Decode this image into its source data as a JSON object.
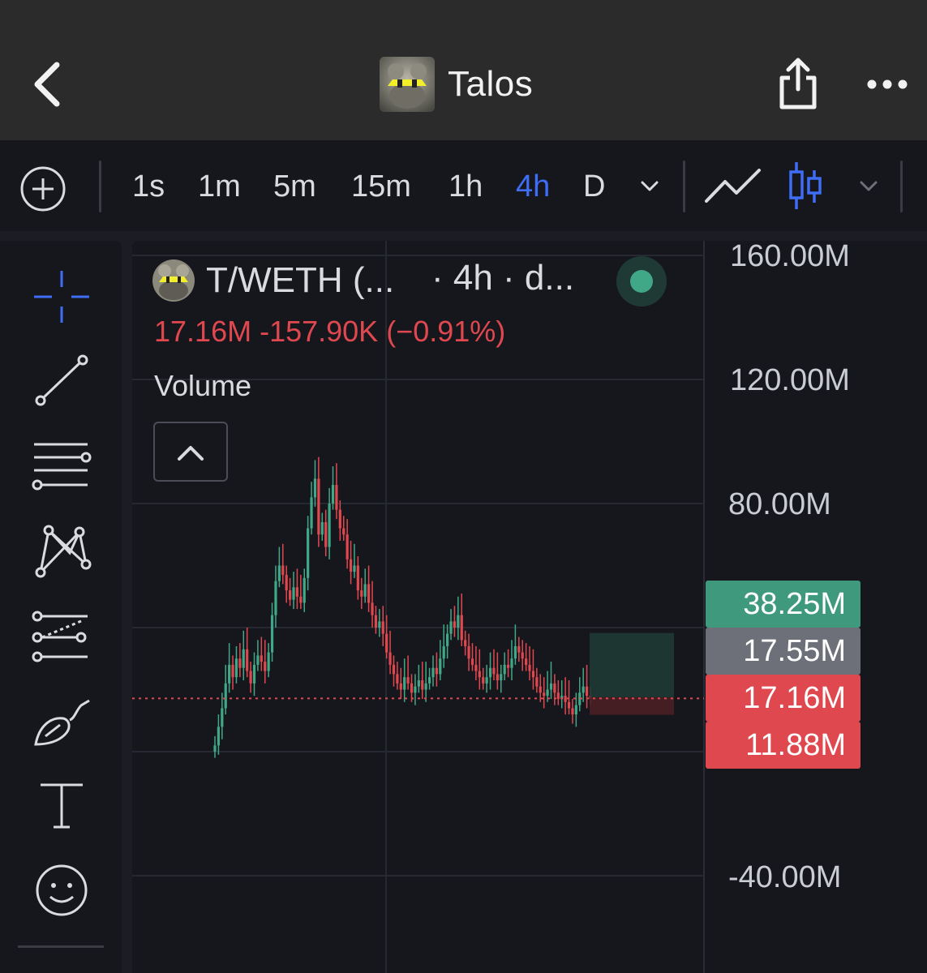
{
  "header": {
    "title": "Talos",
    "logo_text": "T"
  },
  "toolbar": {
    "intervals": [
      "1s",
      "1m",
      "5m",
      "15m",
      "1h",
      "4h",
      "D"
    ],
    "active_interval": "4h"
  },
  "legend": {
    "symbol": "T/WETH (...",
    "interval_text": "· 4h · d...",
    "ohlc_text": "17.16M  -157.90K (−0.91%)",
    "volume_label": "Volume",
    "status": "connected"
  },
  "price_axis": {
    "ticks": [
      "160.00M",
      "120.00M",
      "80.00M",
      "-40.00M"
    ]
  },
  "price_labels": {
    "high": "38.25M",
    "mid": "17.55M",
    "last": "17.16M",
    "low": "11.88M"
  },
  "colors": {
    "accent": "#3f6df5",
    "up": "#40a887",
    "down": "#e0484f",
    "neutral_label": "#6e7079"
  },
  "chart_data": {
    "type": "line",
    "title": "",
    "xlabel": "",
    "ylabel": "",
    "ylim": [
      -40000000,
      160000000
    ],
    "yticks": [
      160000000,
      120000000,
      80000000,
      -40000000
    ],
    "current_price": 17160000,
    "series": [
      {
        "values": [
          2,
          8,
          14,
          22,
          28,
          24,
          30,
          27,
          33,
          26,
          22,
          28,
          31,
          29,
          26,
          32,
          44,
          55,
          60,
          57,
          52,
          49,
          53,
          50,
          48,
          56,
          72,
          82,
          88,
          70,
          74,
          66,
          80,
          86,
          78,
          72,
          70,
          62,
          58,
          60,
          52,
          50,
          54,
          48,
          44,
          40,
          42,
          38,
          32,
          28,
          25,
          22,
          20,
          24,
          22,
          19,
          21,
          23,
          20,
          22,
          24,
          27,
          25,
          30,
          34,
          38,
          42,
          40,
          44,
          36,
          34,
          30,
          28,
          26,
          24,
          22,
          24,
          27,
          25,
          23,
          25,
          28,
          27,
          30,
          34,
          32,
          30,
          28,
          26,
          24,
          21,
          19,
          18,
          20,
          22,
          19,
          17,
          18,
          16,
          14,
          12,
          15,
          19,
          21,
          18,
          17
        ]
      }
    ],
    "position_box": {
      "entry": 17550000,
      "target": 38250000,
      "stop": 11880000
    }
  }
}
